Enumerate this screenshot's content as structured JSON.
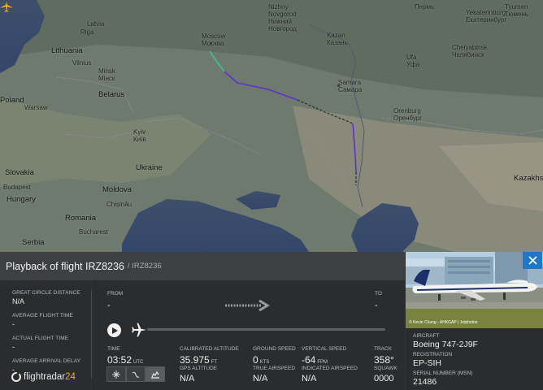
{
  "map": {
    "countries": [
      "Lithuania",
      "Belarus",
      "Poland",
      "Ukraine",
      "Slovakia",
      "Hungary",
      "Moldova",
      "Romania",
      "Serbia",
      "Kazakhs"
    ],
    "cities": [
      {
        "name": "Latvia",
        "ru": ""
      },
      {
        "name": "Riga",
        "ru": ""
      },
      {
        "name": "Vilnius",
        "ru": ""
      },
      {
        "name": "Minsk",
        "ru": "Мінск"
      },
      {
        "name": "Warsaw",
        "ru": ""
      },
      {
        "name": "Kyiv",
        "ru": "Київ"
      },
      {
        "name": "Budapest",
        "ru": ""
      },
      {
        "name": "Chișinău",
        "ru": ""
      },
      {
        "name": "Bucharest",
        "ru": ""
      },
      {
        "name": "Moscow",
        "ru": "Москва"
      },
      {
        "name": "Nizhny Novgorod",
        "ru": "Нижний Новгород"
      },
      {
        "name": "Kazan",
        "ru": "Казань"
      },
      {
        "name": "Ufa",
        "ru": "Уфа"
      },
      {
        "name": "Samara",
        "ru": "Самара"
      },
      {
        "name": "Orenburg",
        "ru": "Оренбург"
      },
      {
        "name": "Chelyabinsk",
        "ru": "Челябинск"
      },
      {
        "name": "Yekaterinburg",
        "ru": "Екатеринбург"
      },
      {
        "name": "Tyumen",
        "ru": "Тюмень"
      },
      {
        "name": "Perm",
        "ru": "Пермь"
      }
    ]
  },
  "title": {
    "main": "Playback of flight IRZ8236",
    "sub": "/ IRZ8236"
  },
  "left_stats": [
    {
      "label": "GREAT CIRCLE DISTANCE",
      "value": "N/A"
    },
    {
      "label": "AVERAGE FLIGHT TIME",
      "value": "-"
    },
    {
      "label": "ACTUAL FLIGHT TIME",
      "value": "-"
    },
    {
      "label": "AVERAGE ARRIVAL DELAY",
      "value": "-"
    }
  ],
  "brand": {
    "name": "flightradar",
    "num": "24"
  },
  "route": {
    "from_label": "FROM",
    "from_value": "-",
    "to_label": "TO",
    "to_value": "-"
  },
  "playback": {
    "progress_pct": 0
  },
  "details": {
    "time_label": "TIME",
    "time_value": "03:52",
    "time_unit": "UTC",
    "cal_alt_label": "CALIBRATED ALTITUDE",
    "cal_alt_value": "35.975",
    "cal_alt_unit": "FT",
    "gps_alt_label": "GPS ALTITUDE",
    "gps_alt_value": "N/A",
    "gs_label": "GROUND SPEED",
    "gs_value": "0",
    "gs_unit": "KTS",
    "tas_label": "TRUE AIRSPEED",
    "tas_value": "N/A",
    "vs_label": "VERTICAL SPEED",
    "vs_value": "-64",
    "vs_unit": "FPM",
    "ias_label": "INDICATED AIRSPEED",
    "ias_value": "N/A",
    "track_label": "TRACK",
    "track_value": "358°",
    "squawk_label": "SQUAWK",
    "squawk_value": "0000"
  },
  "aircraft": {
    "photo_credit": "© Kevin Chung - AHKGAP | Jetphotos",
    "aircraft_label": "AIRCRAFT",
    "aircraft_value": "Boeing 747-2J9F",
    "registration_label": "REGISTRATION",
    "registration_value": "EP-SIH",
    "serial_label": "SERIAL NUMBER (MSN)",
    "serial_value": "21486"
  },
  "colors": {
    "accent_blue": "#1f77c7",
    "brand_yellow": "#f0b01a",
    "track_purple": "#5b2fd6",
    "track_green": "#3fc29a"
  }
}
